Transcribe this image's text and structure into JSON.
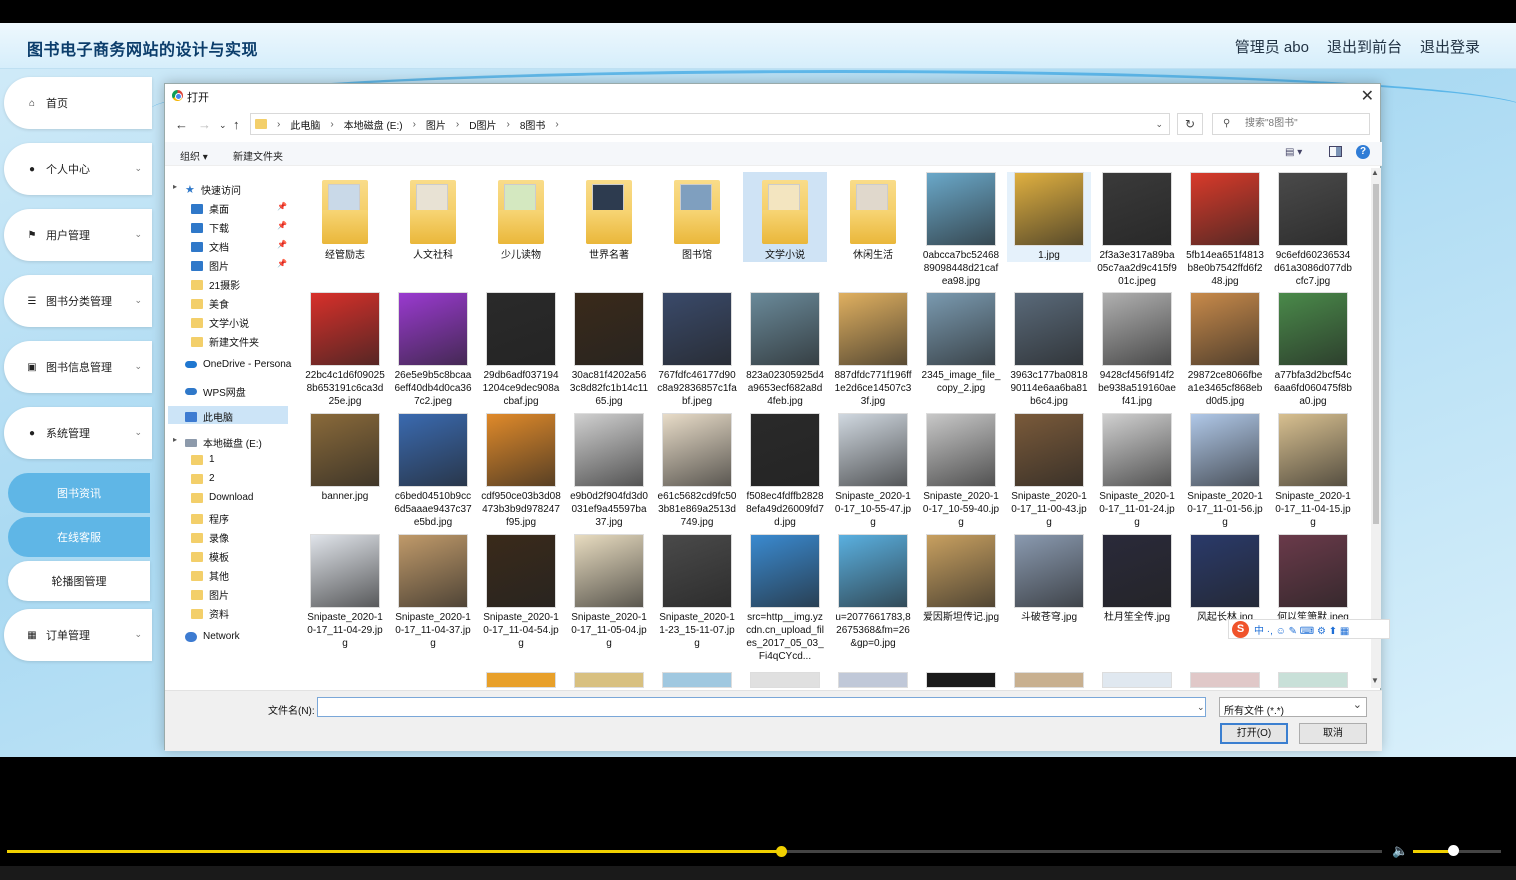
{
  "app": {
    "title": "图书电子商务网站的设计与实现",
    "links": [
      "管理员 abo",
      "退出到前台",
      "退出登录"
    ]
  },
  "sidebar": {
    "items": [
      {
        "label": "首页",
        "icon": "home-icon",
        "chev": ""
      },
      {
        "label": "个人中心",
        "icon": "user-icon",
        "chev": "⌄"
      },
      {
        "label": "用户管理",
        "icon": "flag-icon",
        "chev": "⌄"
      },
      {
        "label": "图书分类管理",
        "icon": "list-icon",
        "chev": "⌄"
      },
      {
        "label": "图书信息管理",
        "icon": "message-icon",
        "chev": "⌄"
      },
      {
        "label": "系统管理",
        "icon": "user-icon",
        "chev": "⌄"
      }
    ],
    "subitems": [
      {
        "label": "图书资讯",
        "active": true
      },
      {
        "label": "在线客服",
        "active": true
      },
      {
        "label": "轮播图管理",
        "active": false
      }
    ],
    "last": {
      "label": "订单管理",
      "icon": "grid-icon",
      "chev": "⌄"
    }
  },
  "dialog": {
    "title": "打开",
    "breadcrumbs": [
      "此电脑",
      "本地磁盘 (E:)",
      "图片",
      "D图片",
      "8图书"
    ],
    "search_placeholder": "搜索\"8图书\"",
    "toolbar": {
      "organize": "组织 ▾",
      "new_folder": "新建文件夹"
    },
    "nav": {
      "quick_access": "快速访问",
      "pinned": [
        "桌面",
        "下载",
        "文档",
        "图片"
      ],
      "folders": [
        "21摄影",
        "美食",
        "文学小说",
        "新建文件夹"
      ],
      "onedrive": "OneDrive - Persona",
      "wps": "WPS网盘",
      "this_pc": "此电脑",
      "drive": "本地磁盘 (E:)",
      "drive_folders": [
        "1",
        "2",
        "Download",
        "程序",
        "录像",
        "模板",
        "其他",
        "图片",
        "资料"
      ],
      "network": "Network"
    },
    "files": [
      {
        "name": "经管励志",
        "type": "folder",
        "color": "#c9d9e8"
      },
      {
        "name": "人文社科",
        "type": "folder",
        "color": "#e8e2d4"
      },
      {
        "name": "少儿读物",
        "type": "folder",
        "color": "#d4e8c0"
      },
      {
        "name": "世界名著",
        "type": "folder",
        "color": "#2d3b4f"
      },
      {
        "name": "图书馆",
        "type": "folder",
        "color": "#7f9fbf"
      },
      {
        "name": "文学小说",
        "type": "folder",
        "color": "#f3e5c0"
      },
      {
        "name": "休闲生活",
        "type": "folder",
        "color": "#e0d8cc"
      },
      {
        "name": "0abcca7bc5246889098448d21cafea98.jpg",
        "type": "img",
        "color": "#6aa8c9"
      },
      {
        "name": "1.jpg",
        "type": "img",
        "color": "#e0b040"
      },
      {
        "name": "2f3a3e317a89ba05c7aa2d9c415f901c.jpeg",
        "type": "img",
        "color": "#3a3a3a"
      },
      {
        "name": "5fb14ea651f4813b8e0b7542ffd6f248.jpg",
        "type": "img",
        "color": "#d93a2a"
      },
      {
        "name": "9c6efd60236534d61a3086d077dbcfc7.jpg",
        "type": "img",
        "color": "#4a4a4a"
      },
      {
        "name": "22bc4c1d6f090258b653191c6ca3d25e.jpg",
        "type": "img",
        "color": "#d8302a"
      },
      {
        "name": "26e5e9b5c8bcaa6eff40db4d0ca367c2.jpeg",
        "type": "img",
        "color": "#9a3ad0"
      },
      {
        "name": "29db6adf0371941204ce9dec908acbaf.jpg",
        "type": "img",
        "color": "#2a2a2a"
      },
      {
        "name": "30ac81f4202a563c8d82fc1b14c1165.jpg",
        "type": "img",
        "color": "#3a2a1a"
      },
      {
        "name": "767fdfc46177d90c8a92836857c1fabf.jpeg",
        "type": "img",
        "color": "#3a4a6a"
      },
      {
        "name": "823a02305925d4a9653ecf682a8d4feb.jpg",
        "type": "img",
        "color": "#6a8a9a"
      },
      {
        "name": "887dfdc771f196ff1e2d6ce14507c33f.jpg",
        "type": "img",
        "color": "#e0b060"
      },
      {
        "name": "2345_image_file_copy_2.jpg",
        "type": "img",
        "color": "#7a9ab0"
      },
      {
        "name": "3963c177ba081890114e6aa6ba81b6c4.jpg",
        "type": "img",
        "color": "#5a6a7a"
      },
      {
        "name": "9428cf456f914f2be938a519160aef41.jpg",
        "type": "img",
        "color": "#b0b0b0"
      },
      {
        "name": "29872ce8066fbea1e3465cf868ebd0d5.jpg",
        "type": "img",
        "color": "#c88a4a"
      },
      {
        "name": "a77bfa3d2bcf54c6aa6fd060475f8ba0.jpg",
        "type": "img",
        "color": "#4a8a4a"
      },
      {
        "name": "banner.jpg",
        "type": "img",
        "color": "#8a6a3a"
      },
      {
        "name": "c6bed04510b9cc6d5aaae9437c37e5bd.jpg",
        "type": "img",
        "color": "#3a6ab0"
      },
      {
        "name": "cdf950ce03b3d08473b3b9d978247f95.jpg",
        "type": "img",
        "color": "#e08a2a"
      },
      {
        "name": "e9b0d2f904fd3d0031ef9a45597ba37.jpg",
        "type": "img",
        "color": "#d0d0d0"
      },
      {
        "name": "e61c5682cd9fc503b81e869a2513d749.jpg",
        "type": "img",
        "color": "#e8dcc8"
      },
      {
        "name": "f508ec4fdffb28288efa49d26009fd7d.jpg",
        "type": "img",
        "color": "#2a2a2a"
      },
      {
        "name": "Snipaste_2020-10-17_10-55-47.jpg",
        "type": "img",
        "color": "#d0d8e0"
      },
      {
        "name": "Snipaste_2020-10-17_10-59-40.jpg",
        "type": "img",
        "color": "#c8c8c8"
      },
      {
        "name": "Snipaste_2020-10-17_11-00-43.jpg",
        "type": "img",
        "color": "#7a5a3a"
      },
      {
        "name": "Snipaste_2020-10-17_11-01-24.jpg",
        "type": "img",
        "color": "#d0d0d0"
      },
      {
        "name": "Snipaste_2020-10-17_11-01-56.jpg",
        "type": "img",
        "color": "#b0c8e8"
      },
      {
        "name": "Snipaste_2020-10-17_11-04-15.jpg",
        "type": "img",
        "color": "#d8c090"
      },
      {
        "name": "Snipaste_2020-10-17_11-04-29.jpg",
        "type": "img",
        "color": "#e0e4ea"
      },
      {
        "name": "Snipaste_2020-10-17_11-04-37.jpg",
        "type": "img",
        "color": "#c09a6a"
      },
      {
        "name": "Snipaste_2020-10-17_11-04-54.jpg",
        "type": "img",
        "color": "#3a2a1a"
      },
      {
        "name": "Snipaste_2020-10-17_11-05-04.jpg",
        "type": "img",
        "color": "#e8dcc0"
      },
      {
        "name": "Snipaste_2020-11-23_15-11-07.jpg",
        "type": "img",
        "color": "#4a4a4a"
      },
      {
        "name": "src=http__img.yzcdn.cn_upload_files_2017_05_03_Fi4qCYcd...",
        "type": "img",
        "color": "#3a8ad0"
      },
      {
        "name": "u=2077661783,82675368&fm=26&gp=0.jpg",
        "type": "img",
        "color": "#5ab0e0"
      },
      {
        "name": "爱因斯坦传记.jpg",
        "type": "img",
        "color": "#c8a060"
      },
      {
        "name": "斗破苍穹.jpg",
        "type": "img",
        "color": "#8a9ab0"
      },
      {
        "name": "杜月笙全传.jpg",
        "type": "img",
        "color": "#2a2a3a"
      },
      {
        "name": "风起长林.jpg",
        "type": "img",
        "color": "#2a3a6a"
      },
      {
        "name": "何以笙箫默.jpeg",
        "type": "img",
        "color": "#6a3a4a"
      }
    ],
    "filename_label": "文件名(N):",
    "filename_value": "",
    "filetype": "所有文件 (*.*)",
    "open_button": "打开(O)",
    "cancel_button": "取消"
  },
  "ime": {
    "logo": "S",
    "text": "中 ·, ☺ ✎ ⌨ ⚙ ⬆ ▦"
  },
  "player": {
    "progress": 0.563,
    "volume": 0.45
  }
}
